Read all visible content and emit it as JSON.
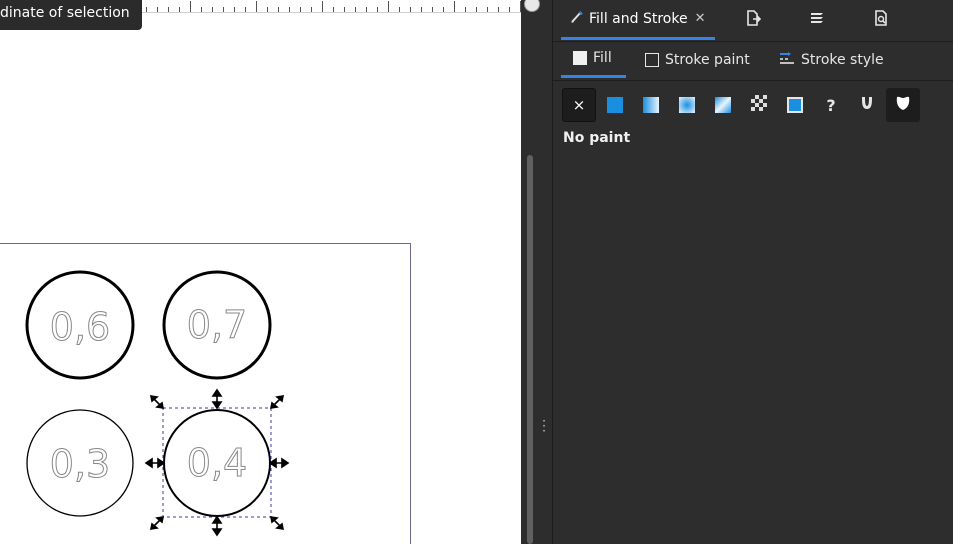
{
  "tooltip": {
    "text": "dinate of selection"
  },
  "canvas": {
    "circles": [
      {
        "label": "0,6",
        "stroke": "thick"
      },
      {
        "label": "0,7",
        "stroke": "thick"
      },
      {
        "label": "0,3",
        "stroke": "thin"
      },
      {
        "label": "0,4",
        "stroke": "medium",
        "selected": true
      }
    ]
  },
  "dock": {
    "tabs": [
      {
        "label": "Fill and Stroke",
        "icon": "brush-icon",
        "closable": true,
        "active": true
      },
      {
        "icon": "export-icon"
      },
      {
        "icon": "layers-icon"
      },
      {
        "icon": "document-properties-icon"
      }
    ]
  },
  "fill_stroke": {
    "subtabs": {
      "fill": "Fill",
      "stroke_paint": "Stroke paint",
      "stroke_style": "Stroke style"
    },
    "paint_types": [
      {
        "name": "no-paint",
        "icon": "×",
        "active": true
      },
      {
        "name": "flat-color"
      },
      {
        "name": "linear-gradient"
      },
      {
        "name": "radial-gradient"
      },
      {
        "name": "mesh-gradient"
      },
      {
        "name": "pattern"
      },
      {
        "name": "swatch"
      },
      {
        "name": "unset",
        "icon": "?"
      },
      {
        "name": "fill-rule-evenodd"
      },
      {
        "name": "fill-rule-nonzero"
      }
    ],
    "status": "No paint"
  },
  "colors": {
    "accent": "#3584e4",
    "panel_bg": "#2d2d2d",
    "paint_blue": "#1a8fe0"
  }
}
